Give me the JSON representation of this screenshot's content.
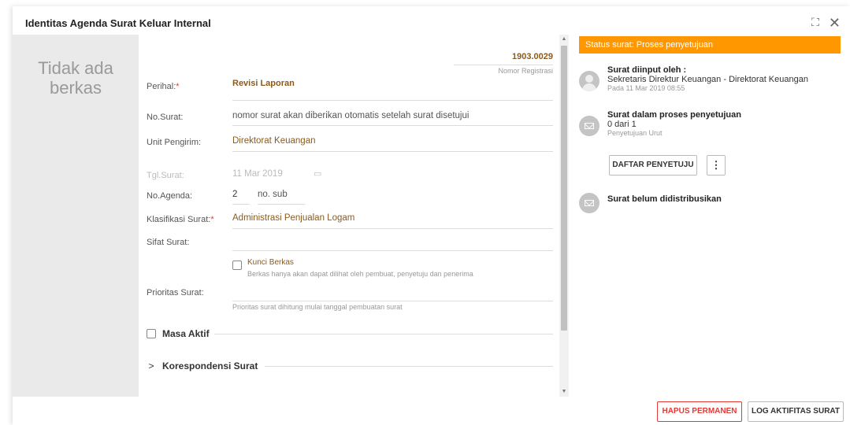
{
  "dialog": {
    "title": "Identitas Agenda Surat Keluar Internal",
    "expand_icon": "expand-icon",
    "close_icon": "close-icon"
  },
  "no_file": {
    "text": "Tidak ada berkas"
  },
  "form": {
    "registration_number": "1903.0029",
    "registration_label": "Nomor Registrasi",
    "perihal_label": "Perihal:",
    "perihal_required": "*",
    "perihal_value": "Revisi Laporan",
    "no_surat_label": "No.Surat:",
    "no_surat_value": "nomor surat akan diberikan otomatis setelah surat disetujui",
    "unit_pengirim_label": "Unit Pengirim:",
    "unit_pengirim_value": "Direktorat Keuangan",
    "tgl_surat_label": "Tgl.Surat:",
    "tgl_surat_value": "11 Mar 2019",
    "no_agenda_label": "No.Agenda:",
    "no_agenda_value": "2",
    "no_sub_placeholder": "no. sub",
    "klasifikasi_label": "Klasifikasi Surat:",
    "klasifikasi_required": "*",
    "klasifikasi_value": "Administrasi Penjualan Logam",
    "sifat_label": "Sifat Surat:",
    "sifat_value": "",
    "kunci_label": "Kunci Berkas",
    "kunci_hint": "Berkas hanya akan dapat dilihat oleh pembuat, penyetuju dan penerima",
    "prioritas_label": "Prioritas Surat:",
    "prioritas_hint": "Prioritas surat dihitung mulai tanggal pembuatan surat",
    "masa_aktif_label": "Masa Aktif",
    "korespondensi_label": "Korespondensi Surat"
  },
  "status": {
    "bar_text": "Status surat: Proses penyetujuan",
    "bar_color": "#ff9800",
    "input_title": "Surat diinput oleh :",
    "input_by": "Sekretaris Direktur Keuangan - Direktorat Keuangan",
    "input_time": "Pada 11 Mar 2019 08:55",
    "approval_title": "Surat dalam proses penyetujuan",
    "approval_count": "0 dari 1",
    "approval_type": "Penyetujuan Urut",
    "approver_button": "DAFTAR PENYETUJU",
    "more_icon": "more-vertical-icon",
    "distribution_title": "Surat belum didistribusikan"
  },
  "footer": {
    "delete_button": "HAPUS PERMANEN",
    "log_button": "LOG AKTIFITAS SURAT"
  }
}
